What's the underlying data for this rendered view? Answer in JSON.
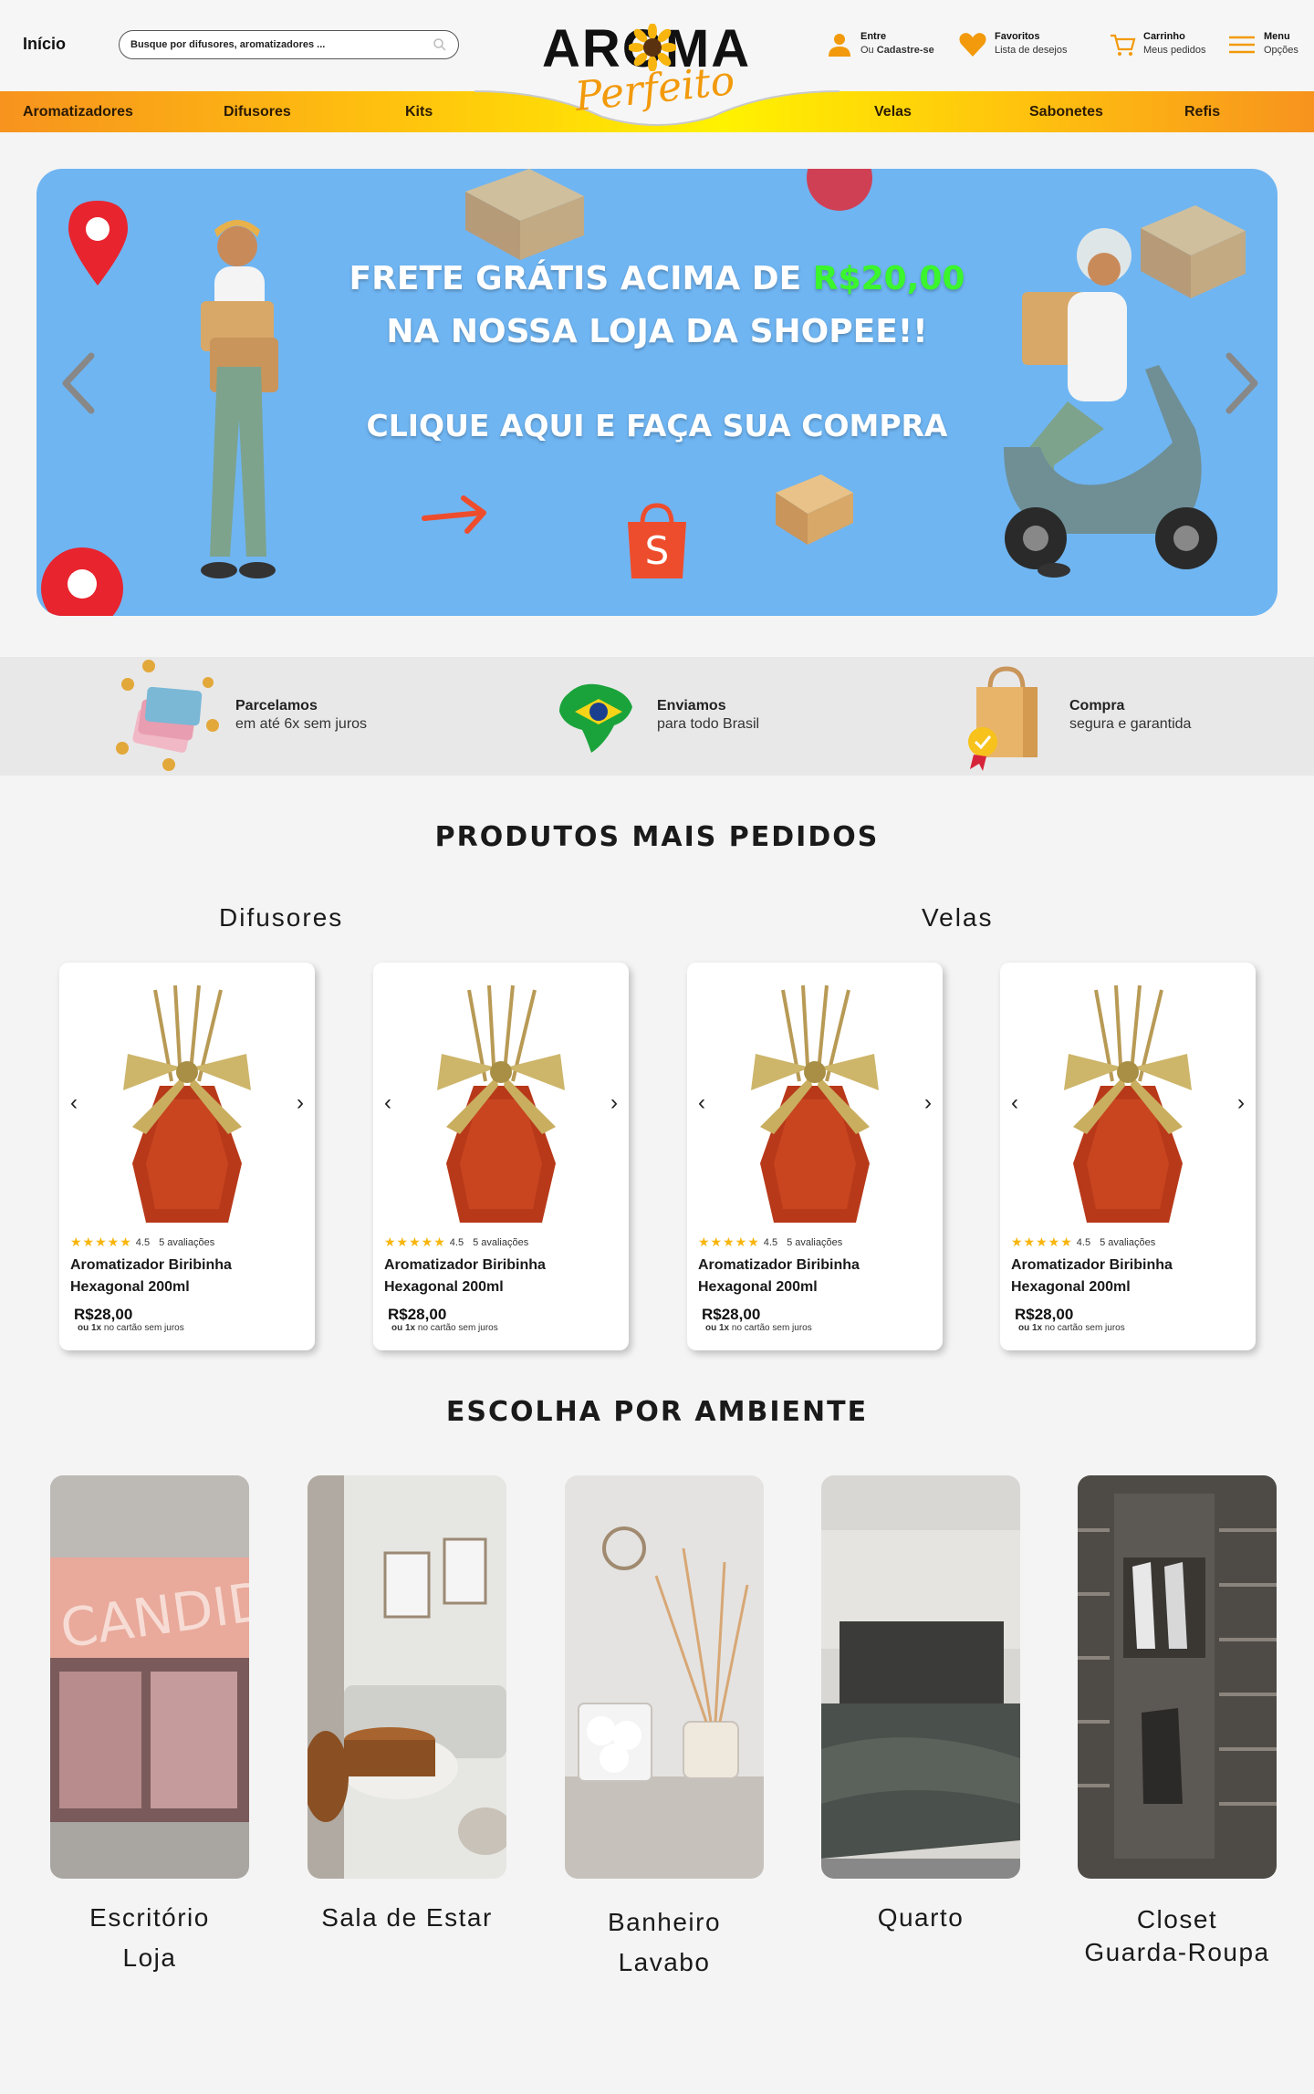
{
  "header": {
    "home_label": "Início",
    "search_placeholder": "Busque por difusores, aromatizadores ...",
    "logo": {
      "word": "AROMA",
      "script": "Perfeito"
    },
    "account": {
      "line1": "Entre",
      "line2_prefix": "Ou",
      "line2_bold": "Cadastre-se"
    },
    "favorites": {
      "line1": "Favoritos",
      "line2": "Lista de desejos"
    },
    "cart": {
      "line1": "Carrinho",
      "line2": "Meus pedidos"
    },
    "menu": {
      "line1": "Menu",
      "line2": "Opções"
    }
  },
  "nav": [
    "Aromatizadores",
    "Difusores",
    "Kits",
    "Velas",
    "Sabonetes",
    "Refis"
  ],
  "banner": {
    "line1_prefix": "FRETE GRÁTIS ACIMA DE",
    "line1_highlight": "R$20,00",
    "line2": "NA NOSSA LOJA DA SHOPEE!!",
    "line3": "CLIQUE AQUI E FAÇA SUA COMPRA"
  },
  "features": [
    {
      "title": "Parcelamos",
      "desc": "em até 6x sem juros",
      "icon": "coins-cards-icon"
    },
    {
      "title": "Enviamos",
      "desc": "para todo Brasil",
      "icon": "brazil-map-icon"
    },
    {
      "title": "Compra",
      "desc": "segura e garantida",
      "icon": "shopping-bag-badge-icon"
    }
  ],
  "best_sellers": {
    "title": "PRODUTOS MAIS PEDIDOS",
    "left_category": "Difusores",
    "right_category": "Velas",
    "products": [
      {
        "rating": "4.5",
        "reviews": "5 avaliações",
        "name": "Aromatizador Biribinha Hexagonal 200ml",
        "price": "R$28,00",
        "inst_bold": "ou 1x",
        "inst_rest": "no cartão sem juros"
      },
      {
        "rating": "4.5",
        "reviews": "5 avaliações",
        "name": "Aromatizador Biribinha Hexagonal 200ml",
        "price": "R$28,00",
        "inst_bold": "ou 1x",
        "inst_rest": "no cartão sem juros"
      },
      {
        "rating": "4.5",
        "reviews": "5 avaliações",
        "name": "Aromatizador Biribinha Hexagonal 200ml",
        "price": "R$28,00",
        "inst_bold": "ou 1x",
        "inst_rest": "no cartão sem juros"
      },
      {
        "rating": "4.5",
        "reviews": "5 avaliações",
        "name": "Aromatizador Biribinha Hexagonal 200ml",
        "price": "R$28,00",
        "inst_bold": "ou 1x",
        "inst_rest": "no cartão sem juros"
      }
    ]
  },
  "ambientes": {
    "title": "ESCOLHA POR AMBIENTE",
    "items": [
      {
        "line1": "Escritório",
        "line2": "Loja"
      },
      {
        "line1": "Sala de Estar",
        "line2": ""
      },
      {
        "line1": "Banheiro",
        "line2": "Lavabo"
      },
      {
        "line1": "Quarto",
        "line2": ""
      },
      {
        "line1": "Closet",
        "line2": "Guarda-Roupa"
      }
    ]
  }
}
